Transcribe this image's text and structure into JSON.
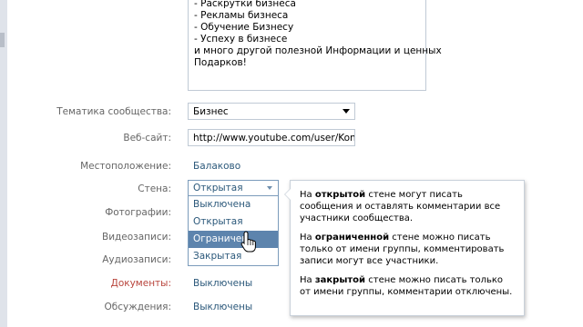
{
  "description_box": {
    "lines": [
      "- Раскрутки бизнеса",
      "- Рекламы бизнеса",
      "- Обучение Бизнесу",
      "- Успеху в бизнесе",
      "и много другой полезной Информации и ценных",
      "Подарков!"
    ]
  },
  "form": {
    "theme": {
      "label": "Тематика сообщества:",
      "value": "Бизнес"
    },
    "website": {
      "label": "Веб-сайт:",
      "value": "http://www.youtube.com/user/Kons"
    },
    "location": {
      "label": "Местоположение:",
      "value": "Балаково"
    },
    "wall": {
      "label": "Стена:",
      "value": "Открытая"
    },
    "photos": {
      "label": "Фотографии:"
    },
    "videos": {
      "label": "Видеозаписи:"
    },
    "audio": {
      "label": "Аудиозаписи:"
    },
    "documents": {
      "label": "Документы:",
      "value": "Выключены"
    },
    "discussions": {
      "label": "Обсуждения:",
      "value": "Выключены"
    }
  },
  "wall_dropdown": {
    "options": [
      "Выключена",
      "Открытая",
      "Ограниченная",
      "Закрытая"
    ],
    "selected_index": 2,
    "selected_display": "Ограничен"
  },
  "tooltip": {
    "p1": {
      "pre": "На ",
      "bold": "открытой",
      "post": " стене могут писать сообщения и оставлять комментарии все участники сообщества."
    },
    "p2": {
      "pre": "На ",
      "bold": "ограниченной",
      "post": " стене можно писать только от имени группы, комментировать записи могут все участники."
    },
    "p3": {
      "pre": "На ",
      "bold": "закрытой",
      "post": " стене можно писать только от имени группы, комментарии отключены."
    }
  },
  "colors": {
    "link": "#2b587a",
    "label": "#666666",
    "label_red": "#b8443c",
    "highlight": "#5d84ad"
  },
  "icons": {
    "dropdown": "chevron-down-icon",
    "cursor": "hand-pointer-icon"
  }
}
